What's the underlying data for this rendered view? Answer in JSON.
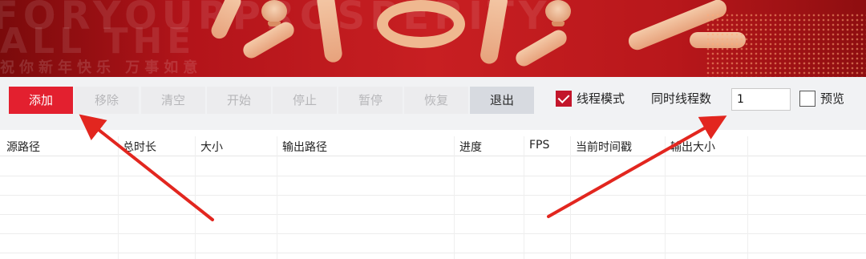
{
  "banner": {
    "ghost_top": "FORYOURPROSPERITY",
    "ghost_mid": "ALL THE",
    "ghost_small": "祝你新年快乐 万事如意"
  },
  "toolbar": {
    "add_label": "添加",
    "remove_label": "移除",
    "clear_label": "清空",
    "start_label": "开始",
    "stop_label": "停止",
    "pause_label": "暂停",
    "resume_label": "恢复",
    "quit_label": "退出",
    "thread_mode_label": "线程模式",
    "thread_mode_checked": true,
    "concurrent_threads_label": "同时线程数",
    "concurrent_threads_value": "1",
    "preview_label": "预览",
    "preview_checked": false
  },
  "table": {
    "columns": [
      "源路径",
      "总时长",
      "大小",
      "输出路径",
      "进度",
      "FPS",
      "当前时间戳",
      "输出大小"
    ],
    "rows": []
  },
  "colors": {
    "accent": "#e3202f",
    "banner": "#c81f22",
    "arrow": "#e2261f"
  }
}
